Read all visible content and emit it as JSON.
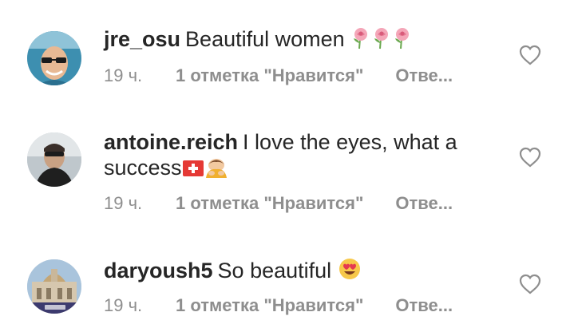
{
  "comments": [
    {
      "username": "jre_osu",
      "text": "Beautiful women",
      "emoji": [
        "rose-icon",
        "rose-icon",
        "rose-icon"
      ],
      "time": "19 ч.",
      "likes": "1 отметка \"Нравится\"",
      "reply": "Отве..."
    },
    {
      "username": "antoine.reich",
      "text_line1": "I love the eyes, what a",
      "text_line2": "success",
      "emoji": [
        "swiss-flag-icon",
        "person-bowing-icon"
      ],
      "time": "19 ч.",
      "likes": "1 отметка \"Нравится\"",
      "reply": "Отве..."
    },
    {
      "username": "daryoush5",
      "text": "So beautiful",
      "emoji": [
        "heart-eyes-face-icon"
      ],
      "time": "19 ч.",
      "likes": "1 отметка \"Нравится\"",
      "reply": "Отве..."
    }
  ],
  "colors": {
    "text": "#262626",
    "meta": "#8e8e8e",
    "heart_outline": "#8e8e8e"
  }
}
